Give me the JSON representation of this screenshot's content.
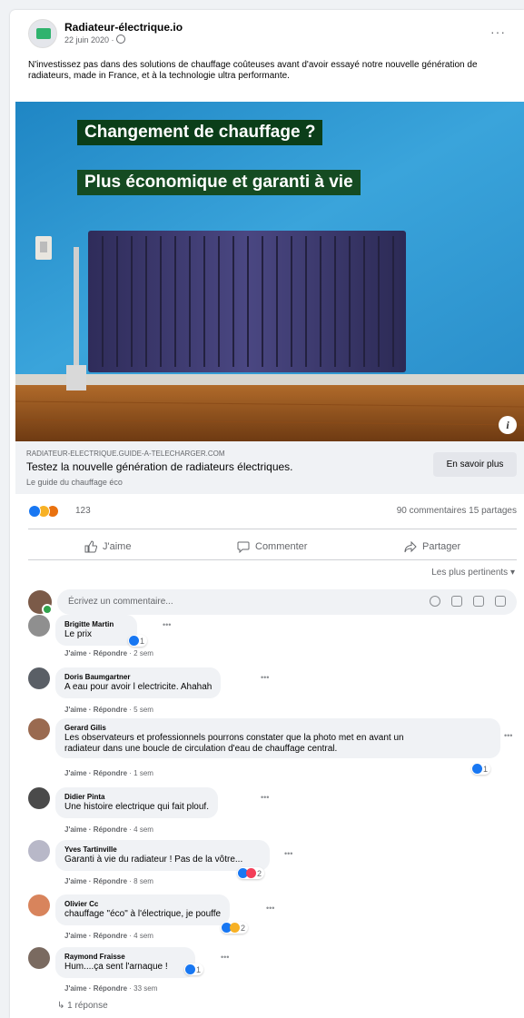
{
  "post": {
    "page_name": "Radiateur-électrique.io",
    "date": "22 juin 2020 · ",
    "text": "N'investissez pas dans des solutions de chauffage coûteuses avant d'avoir essayé notre nouvelle génération de radiateurs, made in France, et à la technologie ultra performante.",
    "image_overlay": [
      "Changement de chauffage ?",
      "Plus économique et garanti à vie"
    ],
    "link": {
      "domain": "RADIATEUR-ELECTRIQUE.GUIDE-A-TELECHARGER.COM",
      "title": "Testez la nouvelle génération de radiateurs électriques.",
      "subtitle": "Le guide du chauffage éco",
      "cta": "En savoir plus"
    },
    "reactions_count": "123",
    "comments_shares": "90 commentaires  15 partages",
    "actions": {
      "like": "J'aime",
      "comment": "Commenter",
      "share": "Partager"
    },
    "sort_label": "Les plus pertinents",
    "compose_placeholder": "Écrivez un commentaire...",
    "more": "···"
  },
  "colors": {
    "like_blue": "#1877f2",
    "love_red": "#f33e58",
    "haha_yellow": "#f7b125",
    "wall_blue": "#2f9bd6",
    "radiator": "#3d3a6e"
  },
  "comments": [
    {
      "name": "Brigitte Martin",
      "lines": [
        "Le prix"
      ],
      "meta_actions": "J'aime · Répondre",
      "time": " · 2 sem",
      "reaction_count": "1"
    },
    {
      "name": "Doris Baumgartner",
      "lines": [
        "A eau pour avoir l electricite. Ahahah"
      ],
      "meta_actions": "J'aime · Répondre",
      "time": " · 5 sem",
      "reaction_count": ""
    },
    {
      "name": "Gerard Gilis",
      "lines": [
        "Les observateurs et professionnels pourrons constater que la photo met en avant un",
        "radiateur dans une boucle de circulation d'eau de chauffage central."
      ],
      "meta_actions": "J'aime · Répondre",
      "time": " · 1 sem",
      "reaction_count": "1"
    },
    {
      "name": "Didier Pinta",
      "lines": [
        "Une histoire electrique qui fait plouf."
      ],
      "meta_actions": "J'aime · Répondre",
      "time": " · 4 sem",
      "reaction_count": ""
    },
    {
      "name": "Yves Tartinville",
      "lines": [
        "Garanti à vie du radiateur ! Pas de la vôtre..."
      ],
      "meta_actions": "J'aime · Répondre",
      "time": " · 8 sem",
      "reaction_count": "2"
    },
    {
      "name": "Olivier Cc",
      "lines": [
        "chauffage \"éco\" à l'électrique, je pouffe"
      ],
      "meta_actions": "J'aime · Répondre",
      "time": " · 4 sem",
      "reaction_count": "2"
    },
    {
      "name": "Raymond Fraisse",
      "lines": [
        "Hum....ça sent l'arnaque !"
      ],
      "meta_actions": "J'aime · Répondre",
      "time": " · 33 sem",
      "reaction_count": "1"
    }
  ],
  "reply_link": "1 réponse"
}
